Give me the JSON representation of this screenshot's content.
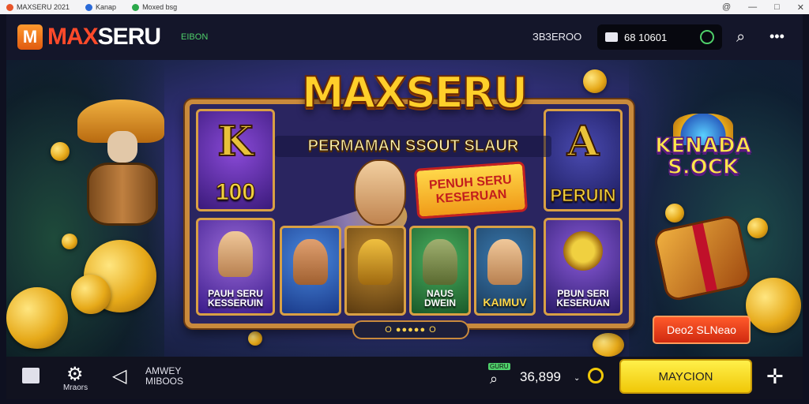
{
  "titlebar": {
    "tabs": [
      {
        "label": "MAXSERU 2021",
        "color": "#e8552a"
      },
      {
        "label": "Kanap",
        "color": "#2a6ad8"
      },
      {
        "label": "Moxed bsg",
        "color": "#2aa84a"
      }
    ],
    "controls": [
      "@",
      "—",
      "□",
      "✕"
    ]
  },
  "header": {
    "logo_letter": "M",
    "logo_max": "MAX",
    "logo_seru": "SERU",
    "tag": "EIBON",
    "balance_label": "ЗВЗЕRОО",
    "wallet_value": "68 10601"
  },
  "game": {
    "title": "MAXSERU",
    "subtitle": "PERMAMAN SSOUT SLAUR",
    "banner": "PENUH SERU\nKESERUAN",
    "right_sign": "KENADA\nS.OCK",
    "top_tiles": [
      {
        "glyph": "K",
        "text": "100",
        "bg": "#5a2a9a"
      },
      {
        "glyph": "A",
        "text": "PERUIN",
        "bg": "#2a2f7a"
      }
    ],
    "bottom_tiles": [
      {
        "text": "PAUH SERU\nKESSERUIN",
        "bg": "#6a3ab0"
      },
      {
        "text": "",
        "bg": "#2a6ab8"
      },
      {
        "text": "",
        "bg": "#8a5a20"
      },
      {
        "text": "NAUS\nDWEIN",
        "bg": "#2a8a4a"
      },
      {
        "text": "KAIMUV",
        "bg": "#2a5a8a"
      },
      {
        "text": "PBUN SERI\nKESERUAN",
        "bg": "#6a3ab0"
      }
    ],
    "pager": "O ●●●●● O",
    "promo_button": "Deo2 SLNeao"
  },
  "bottom": {
    "left_label": "Mraors",
    "menu_label": "AMWEY\nMIBOOS",
    "bet_tag": "GURU",
    "bet_amount": "36,899",
    "spin_label": "MAYCION"
  }
}
